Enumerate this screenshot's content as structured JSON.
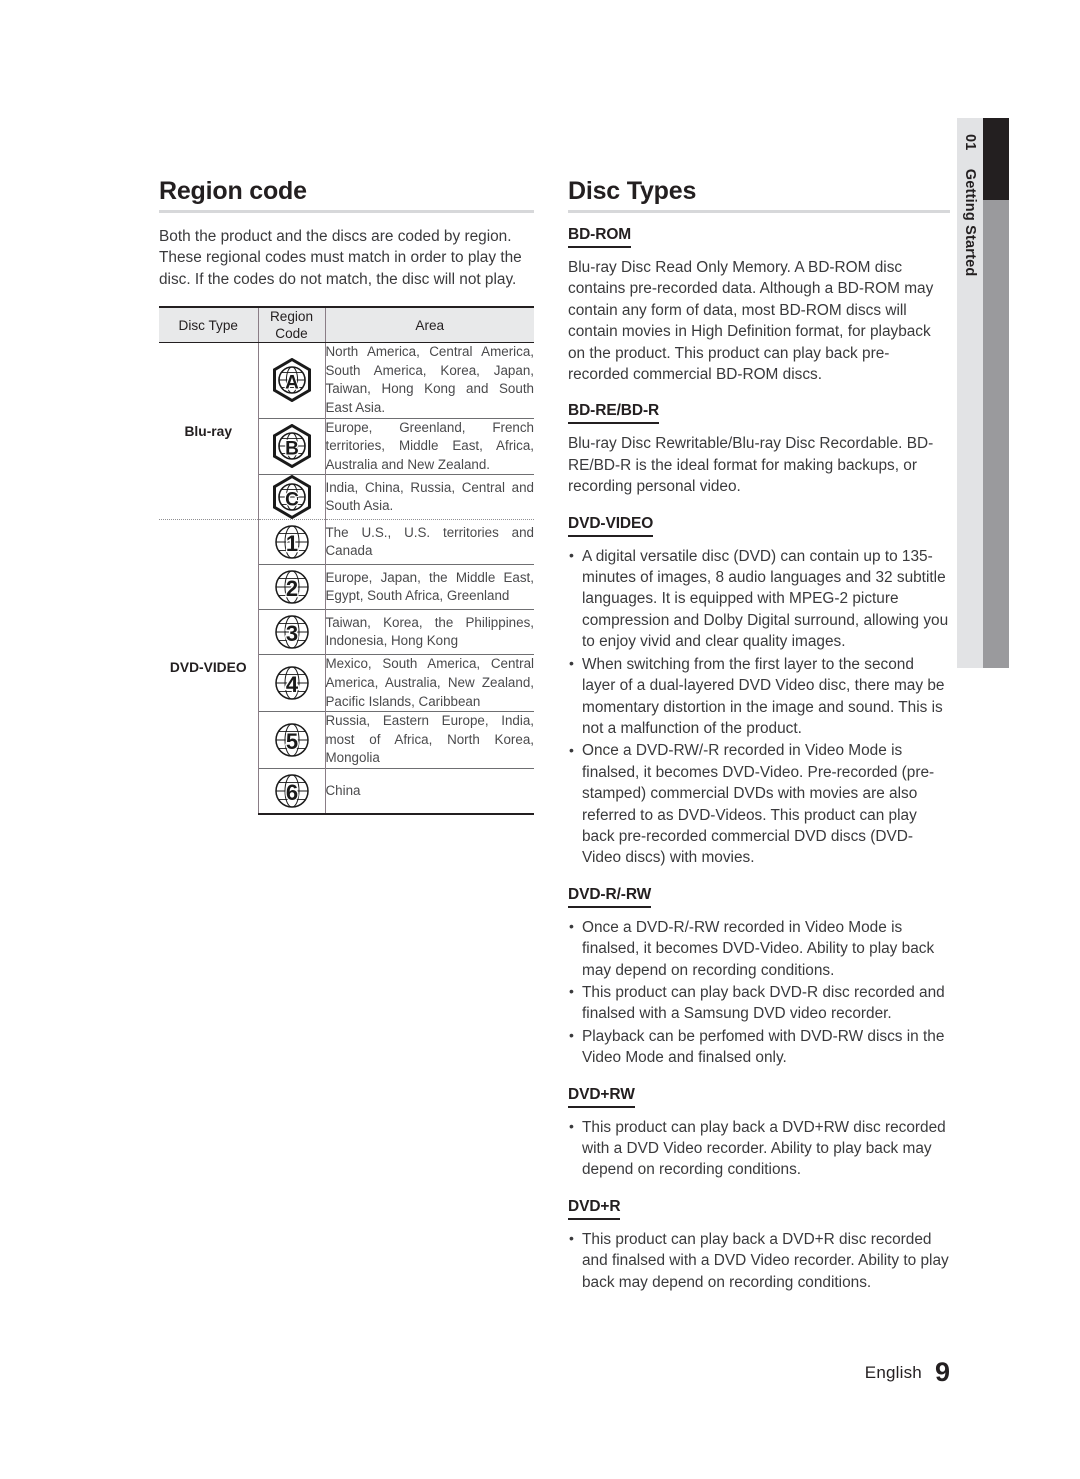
{
  "side_tab": {
    "chapter_number": "01",
    "chapter_title": "Getting Started"
  },
  "left_column": {
    "section_title": "Region code",
    "intro_paragraph": "Both the product and the discs are coded by region. These regional codes must match in order to play the disc. If the codes do not match, the disc will not play.",
    "table": {
      "headers": [
        "Disc Type",
        "Region Code",
        "Area"
      ],
      "header_region_code_line1": "Region",
      "header_region_code_line2": "Code",
      "groups": [
        {
          "disc_type": "Blu-ray",
          "rows": [
            {
              "code": "A",
              "icon": "bluray-region-a-icon",
              "area": "North America, Central America, South America, Korea, Japan, Taiwan, Hong Kong and South East Asia."
            },
            {
              "code": "B",
              "icon": "bluray-region-b-icon",
              "area": "Europe, Greenland, French territories, Middle East, Africa, Australia and New Zealand."
            },
            {
              "code": "C",
              "icon": "bluray-region-c-icon",
              "area": "India, China, Russia, Central and South Asia."
            }
          ]
        },
        {
          "disc_type": "DVD-VIDEO",
          "rows": [
            {
              "code": "1",
              "icon": "dvd-region-1-icon",
              "area": "The U.S., U.S. territories and Canada"
            },
            {
              "code": "2",
              "icon": "dvd-region-2-icon",
              "area": "Europe, Japan, the Middle East, Egypt, South Africa, Greenland"
            },
            {
              "code": "3",
              "icon": "dvd-region-3-icon",
              "area": "Taiwan, Korea, the Philippines, Indonesia, Hong Kong"
            },
            {
              "code": "4",
              "icon": "dvd-region-4-icon",
              "area": "Mexico, South America, Central America, Australia, New Zealand, Pacific Islands, Caribbean"
            },
            {
              "code": "5",
              "icon": "dvd-region-5-icon",
              "area": "Russia, Eastern Europe, India, most of Africa, North Korea, Mongolia"
            },
            {
              "code": "6",
              "icon": "dvd-region-6-icon",
              "area": "China"
            }
          ]
        }
      ]
    }
  },
  "right_column": {
    "section_title": "Disc Types",
    "subsections": [
      {
        "id": "bd-rom",
        "heading": "BD-ROM",
        "paragraph": "Blu-ray Disc Read Only Memory. A BD-ROM disc contains pre-recorded data. Although a BD-ROM may contain any form of data, most BD-ROM discs will contain movies in High Definition format, for playback on the product. This product can play back pre-recorded commercial BD-ROM discs.",
        "bullets": []
      },
      {
        "id": "bd-re-bd-r",
        "heading": "BD-RE/BD-R",
        "paragraph": "Blu-ray Disc Rewritable/Blu-ray Disc Recordable. BD-RE/BD-R is the ideal format for making backups, or recording personal video.",
        "bullets": []
      },
      {
        "id": "dvd-video",
        "heading": "DVD-VIDEO",
        "paragraph": "",
        "bullets": [
          "A digital versatile disc (DVD) can contain up to 135-minutes of images, 8 audio languages and 32 subtitle languages. It is equipped with MPEG-2 picture compression and Dolby Digital surround, allowing you to enjoy vivid and clear quality images.",
          "When switching from the first layer to the second layer of a dual-layered DVD Video disc, there may be momentary distortion in the image and sound. This is not a malfunction of the product.",
          "Once a DVD-RW/-R recorded in Video Mode is finalsed, it becomes DVD-Video. Pre-recorded (pre-stamped) commercial DVDs with movies are also referred to as DVD-Videos. This product can play back pre-recorded commercial DVD discs (DVD-Video discs) with movies."
        ]
      },
      {
        "id": "dvd-r-rw",
        "heading": "DVD-R/-RW",
        "paragraph": "",
        "bullets": [
          "Once a DVD-R/-RW recorded in Video Mode is finalsed, it becomes DVD-Video. Ability to play back may depend on recording conditions.",
          "This product can play back DVD-R disc recorded and finalsed with a Samsung DVD video recorder.",
          "Playback can be perfomed with DVD-RW discs in the Video Mode and finalsed only."
        ]
      },
      {
        "id": "dvd-plus-rw",
        "heading": "DVD+RW",
        "paragraph": "",
        "bullets": [
          "This product can play back a DVD+RW disc recorded with a DVD Video recorder. Ability to play back may depend on recording conditions."
        ]
      },
      {
        "id": "dvd-plus-r",
        "heading": "DVD+R",
        "paragraph": "",
        "bullets": [
          "This product can play back a DVD+R disc recorded and finalsed with a DVD Video recorder. Ability to play back may depend on recording conditions."
        ]
      }
    ]
  },
  "footer": {
    "language": "English",
    "page_number": "9"
  },
  "colors": {
    "text": "#231f20",
    "body_text": "#3a3a3c",
    "rule": "#d7d8da",
    "table_header_bg": "#e8e9ea",
    "tab_light": "#e2e3e5",
    "tab_mid": "#9a9a9d",
    "tab_dark": "#231f20"
  }
}
